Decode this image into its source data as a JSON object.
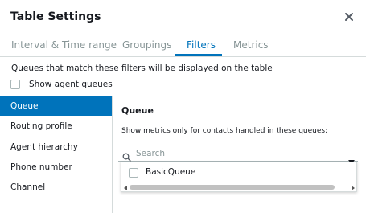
{
  "dialog": {
    "title": "Table Settings"
  },
  "tabs": [
    {
      "label": "Interval & Time range"
    },
    {
      "label": "Groupings"
    },
    {
      "label": "Filters"
    },
    {
      "label": "Metrics"
    }
  ],
  "active_tab": "Filters",
  "filters": {
    "description": "Queues that match these filters will be displayed on the table",
    "show_agent_queues_label": "Show agent queues",
    "show_agent_queues_checked": false
  },
  "sidebar": {
    "items": [
      {
        "label": "Queue"
      },
      {
        "label": "Routing profile"
      },
      {
        "label": "Agent hierarchy"
      },
      {
        "label": "Phone number"
      },
      {
        "label": "Channel"
      }
    ],
    "active": "Queue"
  },
  "panel": {
    "title": "Queue",
    "description": "Show metrics only for contacts handled in these queues:",
    "search_placeholder": "Search",
    "options": [
      {
        "label": "BasicQueue",
        "checked": false
      }
    ]
  },
  "colors": {
    "accent": "#0073bb",
    "text": "#16191f",
    "muted": "#879596",
    "border": "#d5dbdb"
  }
}
